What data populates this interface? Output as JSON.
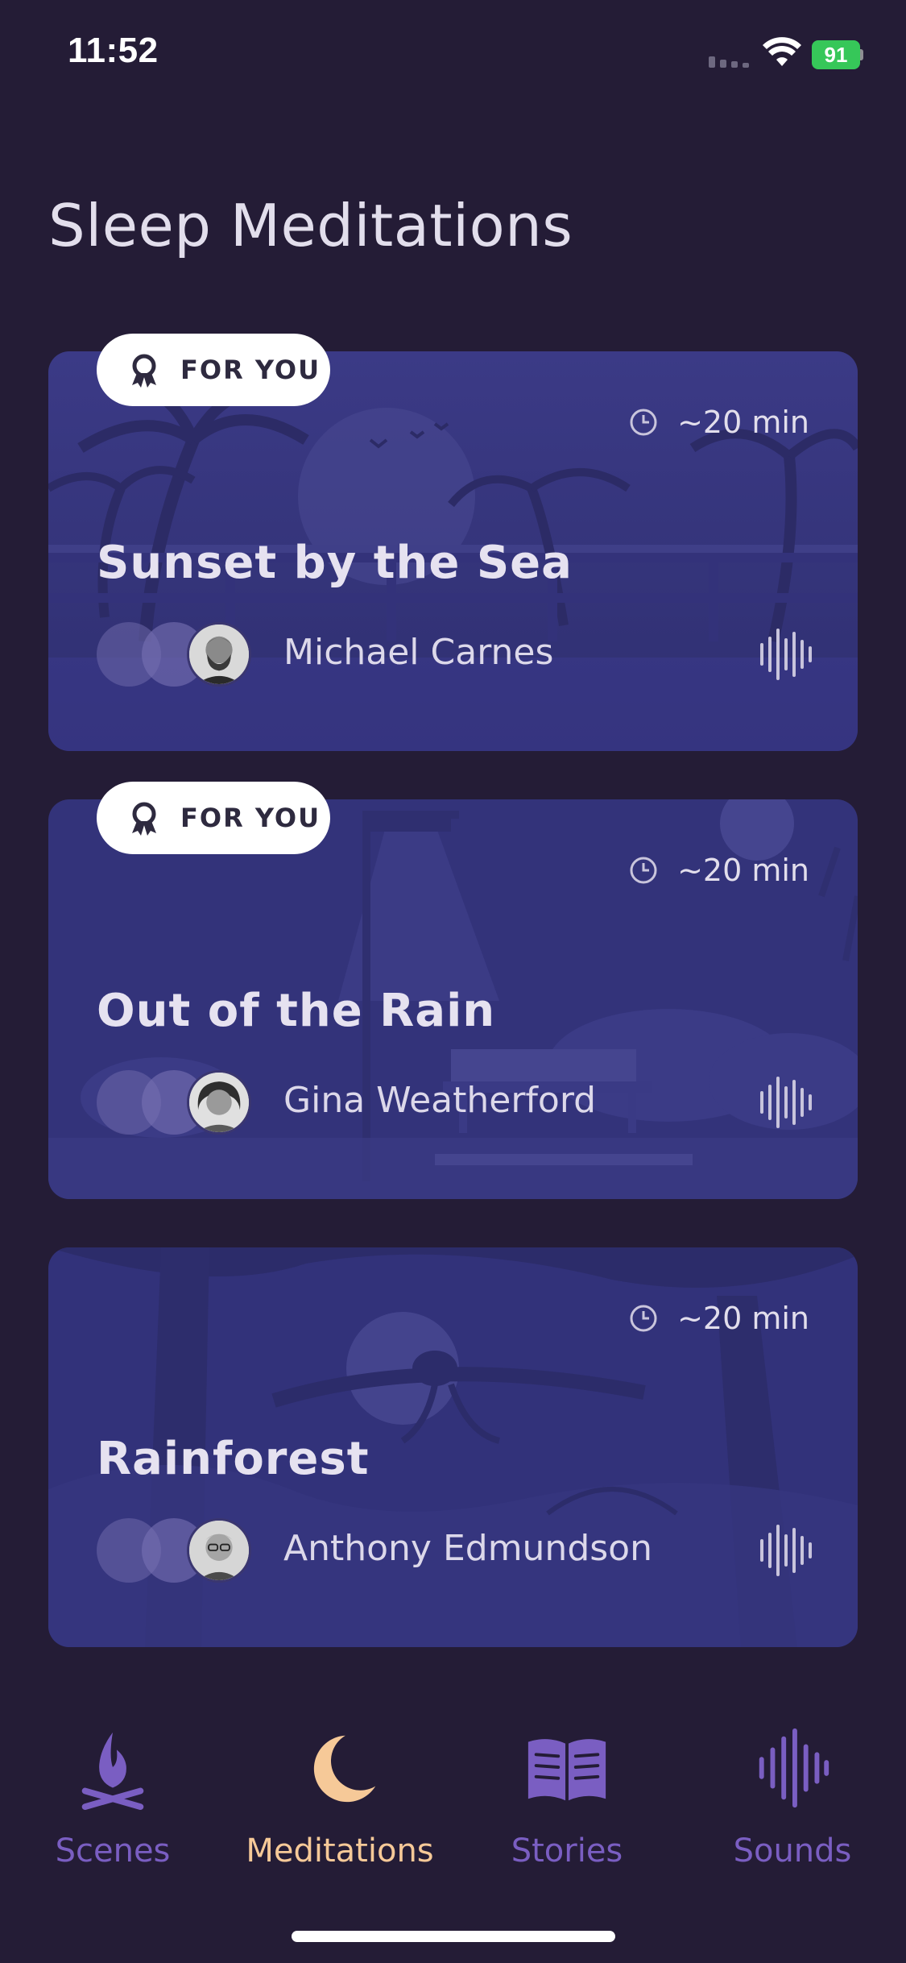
{
  "status_bar": {
    "time": "11:52",
    "battery": "91"
  },
  "page": {
    "title": "Sleep Meditations"
  },
  "cards": [
    {
      "badge": "FOR YOU",
      "duration": "~20 min",
      "title": "Sunset by the Sea",
      "narrator": "Michael Carnes",
      "scene": "sunset-beach"
    },
    {
      "badge": "FOR YOU",
      "duration": "~20 min",
      "title": "Out of the Rain",
      "narrator": "Gina Weatherford",
      "scene": "rainy-park"
    },
    {
      "duration": "~20 min",
      "title": "Rainforest",
      "narrator": "Anthony Edmundson",
      "scene": "jungle-night"
    }
  ],
  "tab_bar": {
    "tabs": [
      {
        "label": "Scenes",
        "icon": "campfire-icon",
        "active": false
      },
      {
        "label": "Meditations",
        "icon": "moon-icon",
        "active": true
      },
      {
        "label": "Stories",
        "icon": "book-icon",
        "active": false
      },
      {
        "label": "Sounds",
        "icon": "waveform-icon",
        "active": false
      }
    ]
  },
  "colors": {
    "background": "#241c36",
    "card": "#35347a",
    "active_tab": "#f6c998",
    "inactive_tab": "#7a5ec2",
    "badge_bg": "#ffffff"
  }
}
